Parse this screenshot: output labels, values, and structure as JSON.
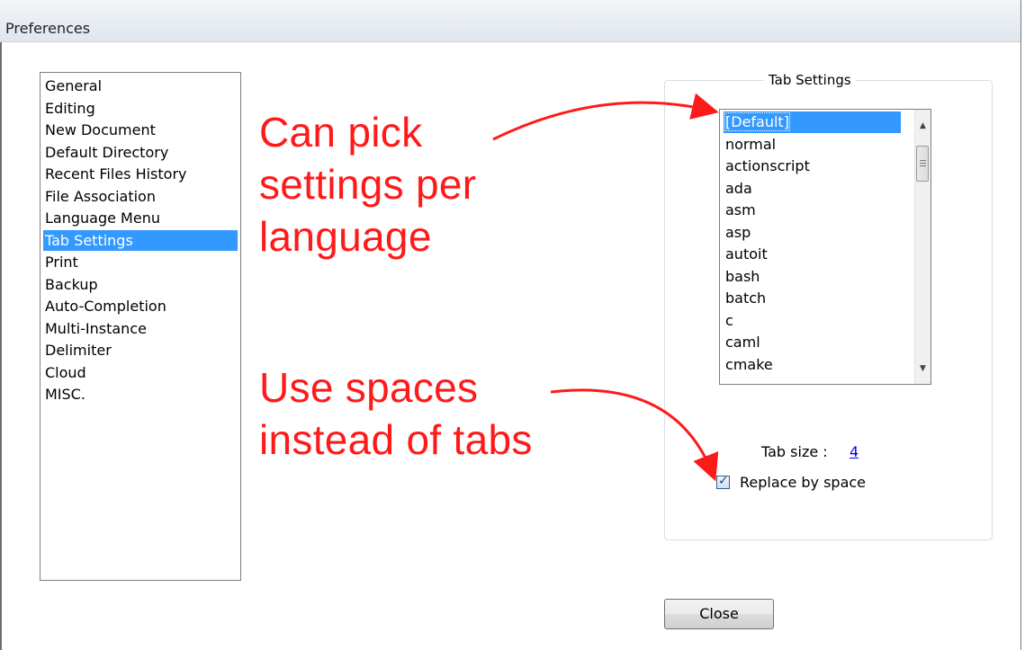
{
  "window": {
    "title": "Preferences"
  },
  "categories": [
    {
      "label": "General",
      "selected": false
    },
    {
      "label": "Editing",
      "selected": false
    },
    {
      "label": "New Document",
      "selected": false
    },
    {
      "label": "Default Directory",
      "selected": false
    },
    {
      "label": "Recent Files History",
      "selected": false
    },
    {
      "label": "File Association",
      "selected": false
    },
    {
      "label": "Language Menu",
      "selected": false
    },
    {
      "label": "Tab Settings",
      "selected": true
    },
    {
      "label": "Print",
      "selected": false
    },
    {
      "label": "Backup",
      "selected": false
    },
    {
      "label": "Auto-Completion",
      "selected": false
    },
    {
      "label": "Multi-Instance",
      "selected": false
    },
    {
      "label": "Delimiter",
      "selected": false
    },
    {
      "label": "Cloud",
      "selected": false
    },
    {
      "label": "MISC.",
      "selected": false
    }
  ],
  "annotations": {
    "pick_line1": "Can pick",
    "pick_line2": "settings per",
    "pick_line3": "language",
    "spaces_line1": "Use spaces",
    "spaces_line2": "instead of tabs",
    "color": "#ff1a1a"
  },
  "tab_settings": {
    "group_title": "Tab Settings",
    "languages": [
      "[Default]",
      "normal",
      "actionscript",
      "ada",
      "asm",
      "asp",
      "autoit",
      "bash",
      "batch",
      "c",
      "caml",
      "cmake"
    ],
    "selected_language": "[Default]",
    "tab_size_label": "Tab size :",
    "tab_size_value": "4",
    "replace_by_space_label": "Replace by space",
    "replace_by_space_checked": true
  },
  "buttons": {
    "close_label": "Close"
  },
  "icons": {
    "scroll_up": "scroll-up-arrow-icon",
    "scroll_down": "scroll-down-arrow-icon",
    "check": "checkmark-icon"
  },
  "colors": {
    "selection": "#3399ff",
    "annotation": "#ff1a1a",
    "link": "#0000ee"
  }
}
